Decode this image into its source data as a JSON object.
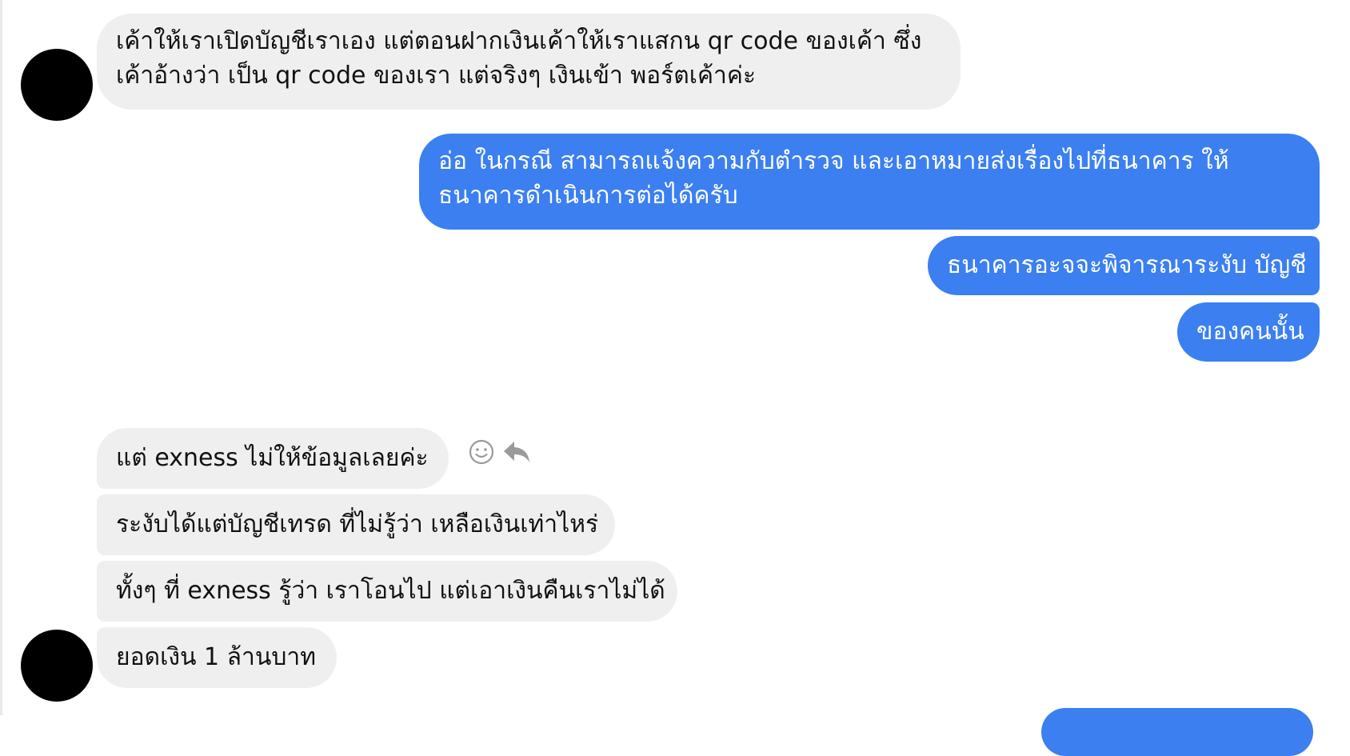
{
  "colors": {
    "incoming_bubble": "#efefef",
    "outgoing_bubble": "#3b7ff1",
    "avatar": "#000000",
    "icon": "#9a9a9a"
  },
  "messages": [
    {
      "direction": "incoming",
      "lines": [
        "เค้าให้เราเปิดบัญชีเราเอง แต่ตอนฝากเงินเค้าให้เราแสกน qr code ของเค้า ซึ่ง",
        "เค้าอ้างว่า เป็น qr code ของเรา แต่จริงๆ  เงินเข้า พอร์ตเค้าค่ะ"
      ]
    },
    {
      "direction": "outgoing",
      "lines": [
        "อ่อ ในกรณี สามารถแจ้งความกับตำรวจ และเอาหมายส่งเรื่องไปที่ธนาคาร ให้",
        "ธนาคารดำเนินการต่อได้ครับ"
      ]
    },
    {
      "direction": "outgoing",
      "lines": [
        "ธนาคารอะจจะพิจารณาระงับ บัญชี"
      ]
    },
    {
      "direction": "outgoing",
      "lines": [
        "ของคนนั้น"
      ]
    },
    {
      "direction": "incoming",
      "lines": [
        "แต่ exness ไม่ให้ข้อมูลเลยค่ะ"
      ]
    },
    {
      "direction": "incoming",
      "lines": [
        "ระงับได้แต่บัญชีเทรด ที่ไม่รู้ว่า เหลือเงินเท่าไหร่"
      ]
    },
    {
      "direction": "incoming",
      "lines": [
        "ทั้งๆ ที่ exness รู้ว่า เราโอนไป แต่เอาเงินคืนเราไม่ได้"
      ]
    },
    {
      "direction": "incoming",
      "lines": [
        "ยอดเงิน 1 ล้านบาท"
      ]
    }
  ],
  "message_actions": [
    {
      "icon": "smiley-icon"
    },
    {
      "icon": "reply-icon"
    }
  ]
}
